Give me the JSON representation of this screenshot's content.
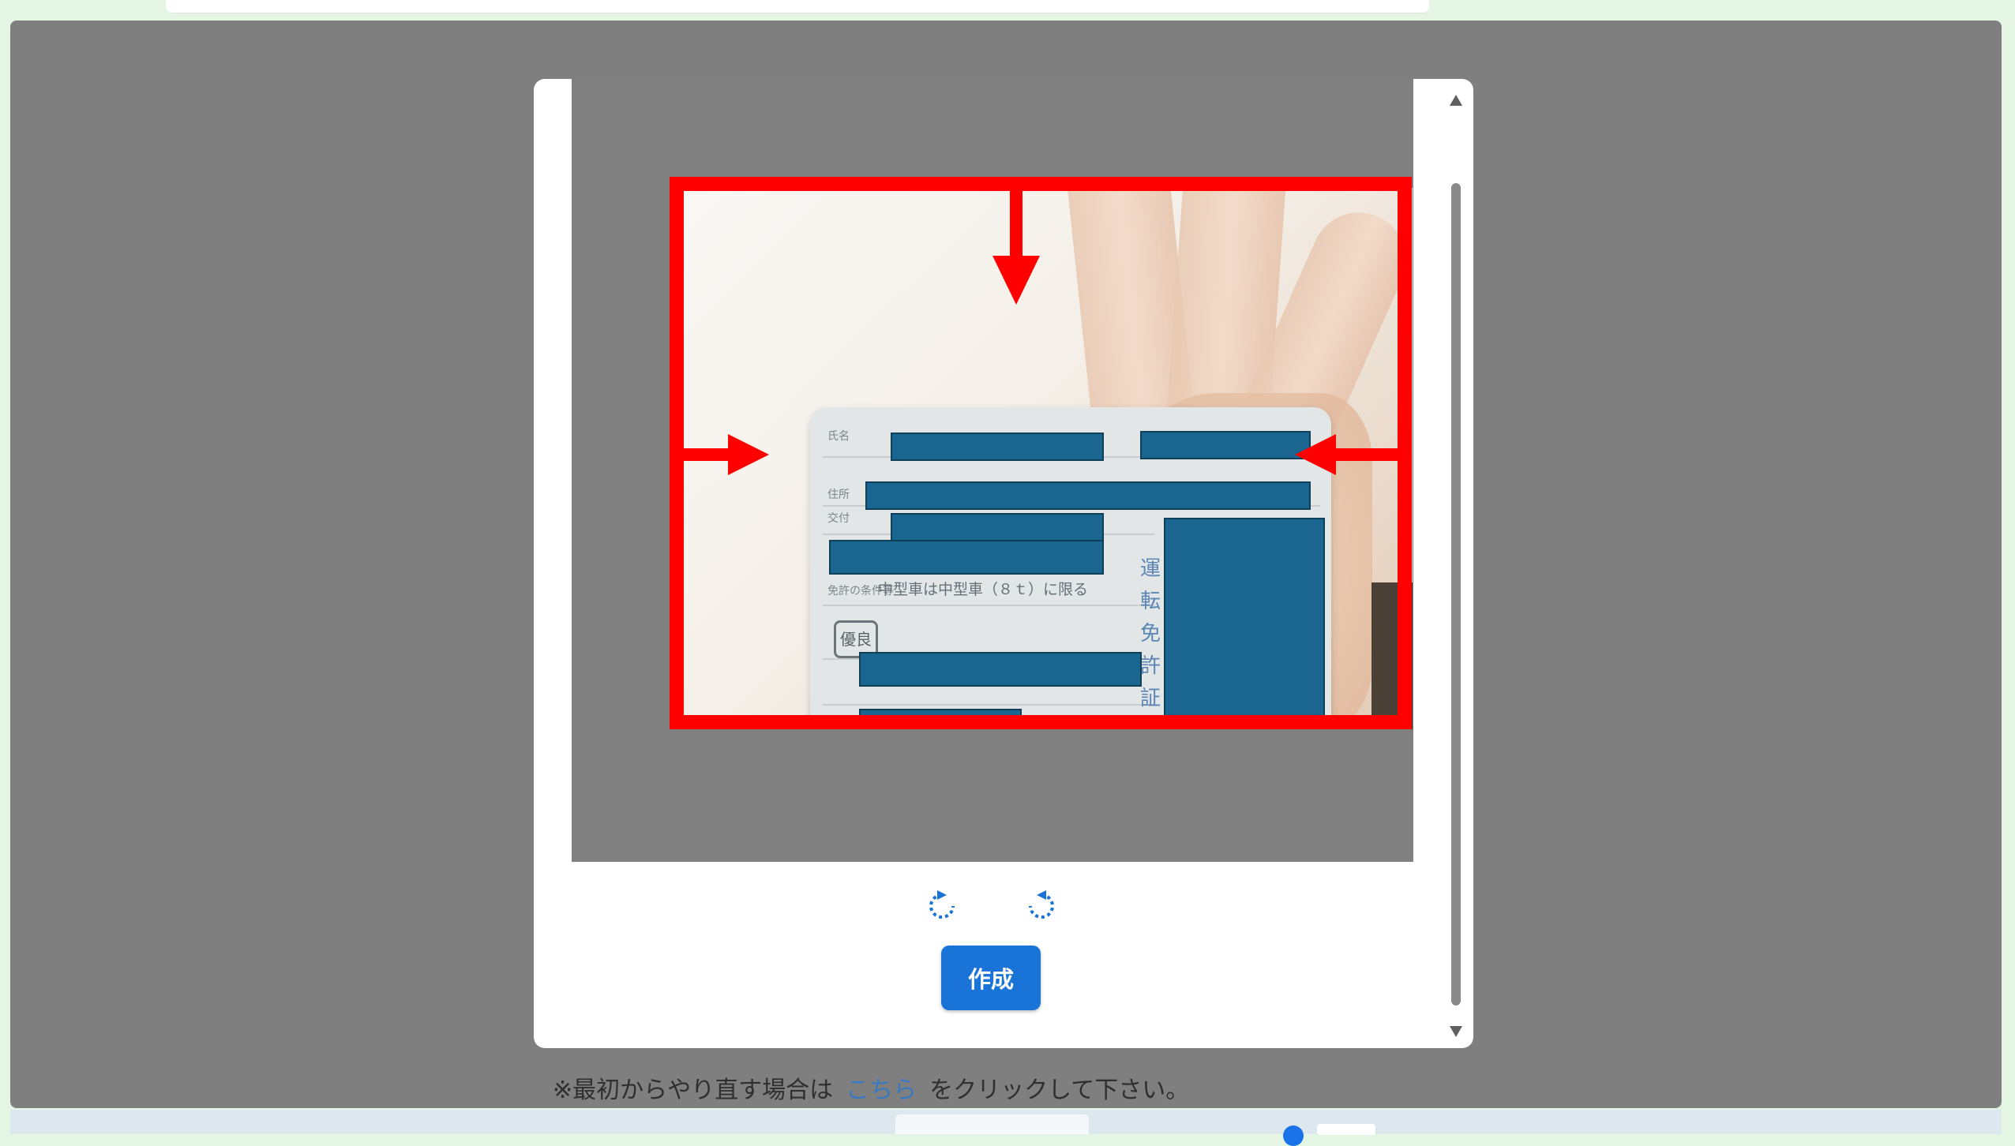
{
  "page": {
    "restart_prefix": "※最初からやり直す場合は",
    "restart_link": "こちら",
    "restart_suffix": "をクリックして下さい。"
  },
  "editor": {
    "create_label": "作成",
    "rotate_left_icon": "rotate-left-icon",
    "rotate_right_icon": "rotate-right-icon"
  },
  "license_card": {
    "condition_text": "中型車は中型車（８ｔ）に限る",
    "vertical_title": [
      "運",
      "転",
      "免",
      "許",
      "証"
    ],
    "stamp_text": "優良"
  },
  "colors": {
    "overlay": "#7f7f7f",
    "crop_guide": "#ff0000",
    "primary_button": "#1a73d6",
    "redaction": "#1a6690",
    "link": "#3a78c0"
  }
}
